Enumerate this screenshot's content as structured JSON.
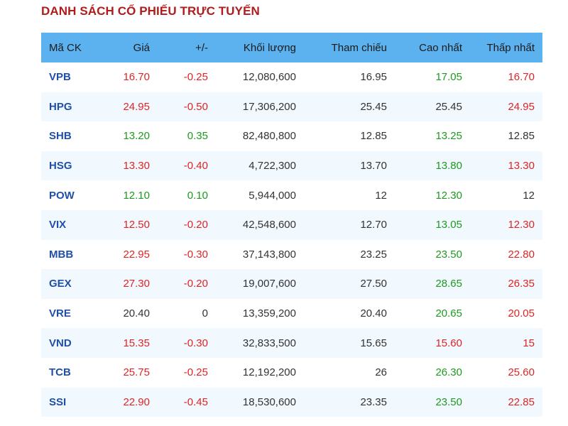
{
  "title": "DANH SÁCH CỔ PHIẾU TRỰC TUYẾN",
  "colors": {
    "title": "#b01c1c",
    "header_bg": "#5bb2ee",
    "up": "#1e9a1e",
    "down": "#e02424",
    "reference": "#333333",
    "symbol": "#1f4fa8"
  },
  "table": {
    "headers": {
      "symbol": "Mã CK",
      "price": "Giá",
      "change": "+/-",
      "volume": "Khối lượng",
      "reference": "Tham chiếu",
      "high": "Cao nhất",
      "low": "Thấp nhất"
    },
    "rows": [
      {
        "symbol": "VPB",
        "price": "16.70",
        "change": "-0.25",
        "volume": "12,080,600",
        "reference": "16.95",
        "high": "17.05",
        "low": "16.70",
        "price_status": "down",
        "change_status": "down",
        "high_status": "up",
        "low_status": "down"
      },
      {
        "symbol": "HPG",
        "price": "24.95",
        "change": "-0.50",
        "volume": "17,306,200",
        "reference": "25.45",
        "high": "25.45",
        "low": "24.95",
        "price_status": "down",
        "change_status": "down",
        "high_status": "ref",
        "low_status": "down"
      },
      {
        "symbol": "SHB",
        "price": "13.20",
        "change": "0.35",
        "volume": "82,480,800",
        "reference": "12.85",
        "high": "13.25",
        "low": "12.85",
        "price_status": "up",
        "change_status": "up",
        "high_status": "up",
        "low_status": "ref"
      },
      {
        "symbol": "HSG",
        "price": "13.30",
        "change": "-0.40",
        "volume": "4,722,300",
        "reference": "13.70",
        "high": "13.80",
        "low": "13.30",
        "price_status": "down",
        "change_status": "down",
        "high_status": "up",
        "low_status": "down"
      },
      {
        "symbol": "POW",
        "price": "12.10",
        "change": "0.10",
        "volume": "5,944,000",
        "reference": "12",
        "high": "12.30",
        "low": "12",
        "price_status": "up",
        "change_status": "up",
        "high_status": "up",
        "low_status": "ref"
      },
      {
        "symbol": "VIX",
        "price": "12.50",
        "change": "-0.20",
        "volume": "42,548,600",
        "reference": "12.70",
        "high": "13.05",
        "low": "12.30",
        "price_status": "down",
        "change_status": "down",
        "high_status": "up",
        "low_status": "down"
      },
      {
        "symbol": "MBB",
        "price": "22.95",
        "change": "-0.30",
        "volume": "37,143,800",
        "reference": "23.25",
        "high": "23.50",
        "low": "22.80",
        "price_status": "down",
        "change_status": "down",
        "high_status": "up",
        "low_status": "down"
      },
      {
        "symbol": "GEX",
        "price": "27.30",
        "change": "-0.20",
        "volume": "19,007,600",
        "reference": "27.50",
        "high": "28.65",
        "low": "26.35",
        "price_status": "down",
        "change_status": "down",
        "high_status": "up",
        "low_status": "down"
      },
      {
        "symbol": "VRE",
        "price": "20.40",
        "change": "0",
        "volume": "13,359,200",
        "reference": "20.40",
        "high": "20.65",
        "low": "20.05",
        "price_status": "ref",
        "change_status": "ref",
        "high_status": "up",
        "low_status": "down"
      },
      {
        "symbol": "VND",
        "price": "15.35",
        "change": "-0.30",
        "volume": "32,833,500",
        "reference": "15.65",
        "high": "15.60",
        "low": "15",
        "price_status": "down",
        "change_status": "down",
        "high_status": "down",
        "low_status": "down"
      },
      {
        "symbol": "TCB",
        "price": "25.75",
        "change": "-0.25",
        "volume": "12,192,200",
        "reference": "26",
        "high": "26.30",
        "low": "25.60",
        "price_status": "down",
        "change_status": "down",
        "high_status": "up",
        "low_status": "down"
      },
      {
        "symbol": "SSI",
        "price": "22.90",
        "change": "-0.45",
        "volume": "18,530,600",
        "reference": "23.35",
        "high": "23.50",
        "low": "22.85",
        "price_status": "down",
        "change_status": "down",
        "high_status": "up",
        "low_status": "down"
      }
    ]
  }
}
